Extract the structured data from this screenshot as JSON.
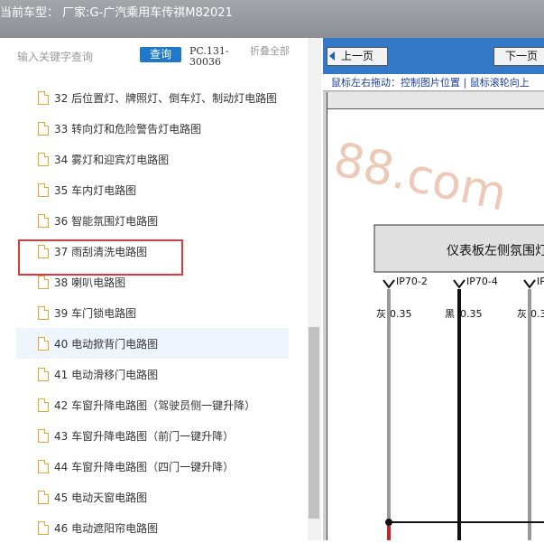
{
  "title_bar": {
    "text": "当前车型： 厂家:G-广汽乘用车传祺M82021"
  },
  "search": {
    "placeholder": "输入关键字查询",
    "query_button": "查询",
    "pc_code": "PC.131-30036",
    "collapse_all": "折叠全部"
  },
  "tree": {
    "items": [
      {
        "label": "32 后位置灯、牌照灯、倒车灯、制动灯电路图"
      },
      {
        "label": "33 转向灯和危险警告灯电路图"
      },
      {
        "label": "34 雾灯和迎宾灯电路图"
      },
      {
        "label": "35 车内灯电路图"
      },
      {
        "label": "36 智能氛围灯电路图"
      },
      {
        "label": "37 雨刮清洗电路图"
      },
      {
        "label": "38 喇叭电路图"
      },
      {
        "label": "39 车门锁电路图"
      },
      {
        "label": "40 电动掀背门电路图"
      },
      {
        "label": "41 电动滑移门电路图"
      },
      {
        "label": "42 车窗升降电路图（驾驶员侧一键升降）"
      },
      {
        "label": "43 车窗升降电路图（前门一键升降）"
      },
      {
        "label": "44 车窗升降电路图（四门一键升降）"
      },
      {
        "label": "45 电动天窗电路图"
      },
      {
        "label": "46 电动遮阳帘电路图"
      }
    ],
    "selected_index": 4,
    "hover_index": 8
  },
  "viewer": {
    "prev_button": "上一页",
    "next_button": "下一页",
    "hint": "鼠标左右拖动：控制图片位置 | 鼠标滚轮向上",
    "watermark": "88.com",
    "diagram": {
      "module_label": "仪表板左侧氛围灯",
      "pins": [
        {
          "id": "IP70-2",
          "wire": "灰",
          "gauge": "0.35"
        },
        {
          "id": "IP70-4",
          "wire": "黑",
          "gauge": "0.35"
        },
        {
          "id": "IP",
          "wire": "灰",
          "gauge": "0.3"
        }
      ]
    }
  },
  "colors": {
    "accent": "#1f78c8",
    "selection_outline": "#e0393b",
    "titlebar": "#989ba0"
  }
}
